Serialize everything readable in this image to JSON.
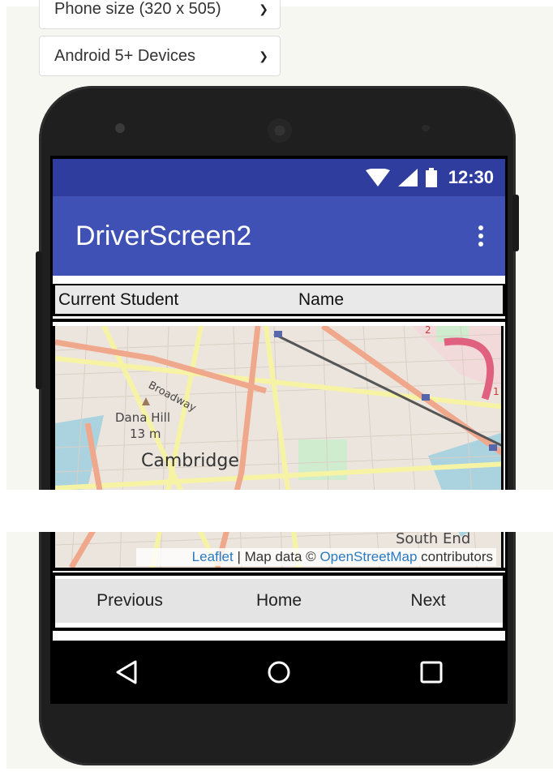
{
  "designer": {
    "size_select": {
      "value": "Phone size (320 x 505)"
    },
    "android_select": {
      "value": "Android 5+ Devices"
    }
  },
  "statusbar": {
    "time": "12:30",
    "icons": [
      "wifi-icon",
      "signal-icon",
      "battery-icon"
    ]
  },
  "appbar": {
    "title": "DriverScreen2",
    "menu_icon": "overflow-menu-icon"
  },
  "student_row": {
    "label": "Current Student",
    "value": "Name"
  },
  "map": {
    "labels": {
      "broadway": "Broadway",
      "dana_hill": "Dana Hill",
      "elevation": "13 m",
      "cambridge": "Cambridge",
      "south_end": "South End",
      "route": "2",
      "route_right": "1"
    },
    "attribution": {
      "leaflet": "Leaflet",
      "separator": " | Map data © ",
      "osm": "OpenStreetMap",
      "suffix": " contributors"
    }
  },
  "buttons": {
    "previous": "Previous",
    "home": "Home",
    "next": "Next"
  },
  "navbar": {
    "icons": [
      "back-icon",
      "home-circle-icon",
      "recents-icon"
    ]
  },
  "colors": {
    "statusbar": "#2f3e9e",
    "appbar": "#3f51b5",
    "link": "#2a7ac1"
  }
}
